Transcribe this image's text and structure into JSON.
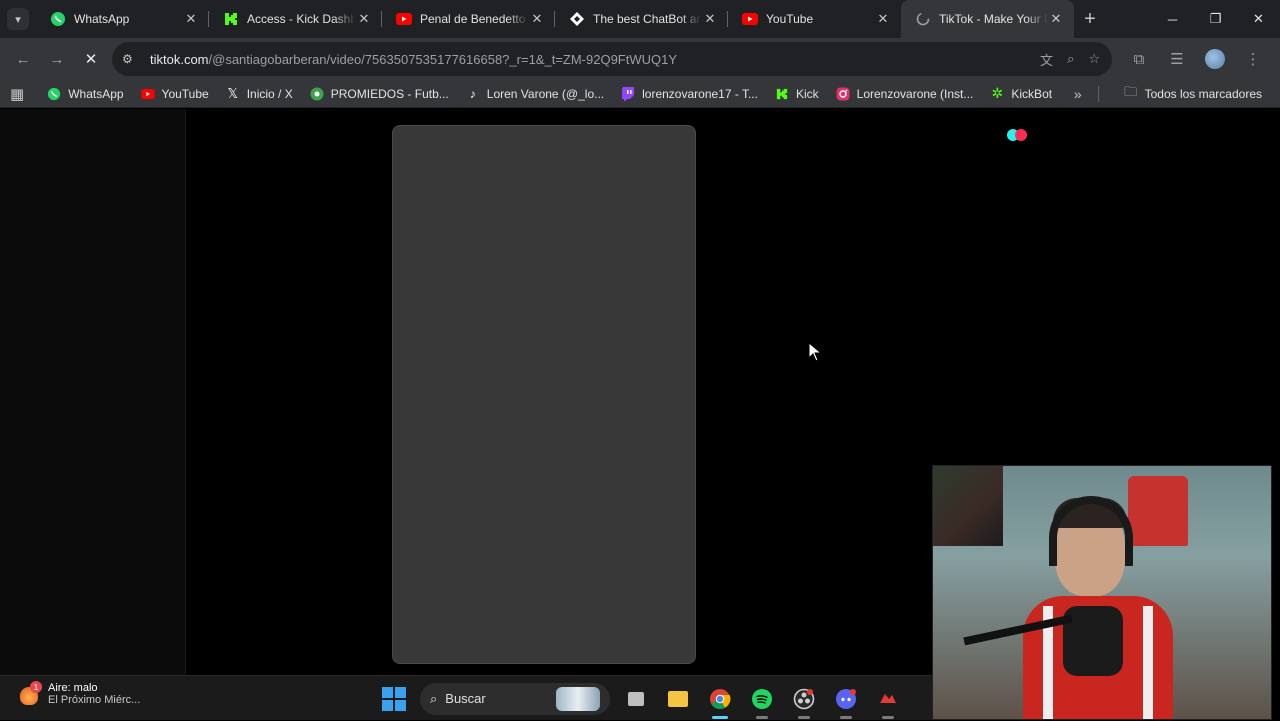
{
  "tabs": [
    {
      "title": "WhatsApp",
      "icon": "whatsapp-icon",
      "color": "#25d366",
      "active": false
    },
    {
      "title": "Access - Kick Dashboard",
      "icon": "kick-icon",
      "color": "#53fc18",
      "active": false
    },
    {
      "title": "Penal de Benedetto a",
      "icon": "youtube-icon",
      "color": "#ff0000",
      "active": false
    },
    {
      "title": "The best ChatBot and",
      "icon": "chatbot-icon",
      "color": "#ffffff",
      "active": false
    },
    {
      "title": "YouTube",
      "icon": "youtube-icon",
      "color": "#ff0000",
      "active": false
    },
    {
      "title": "TikTok - Make Your Day",
      "icon": "loading-icon",
      "color": "#9aa0a6",
      "active": true
    }
  ],
  "toolbar": {
    "url_host": "tiktok.com",
    "url_path": "/@santiagobarberan/video/7563507535177616658?_r=1&_t=ZM-92Q9FtWUQ1Y"
  },
  "bookmarks": [
    {
      "label": "WhatsApp",
      "icon": "whatsapp-icon",
      "color": "#25d366"
    },
    {
      "label": "YouTube",
      "icon": "youtube-icon",
      "color": "#ff0000"
    },
    {
      "label": "Inicio / X",
      "icon": "x-icon",
      "color": "#ffffff"
    },
    {
      "label": "PROMIEDOS - Futb...",
      "icon": "promiedos-icon",
      "color": "#3ea34b"
    },
    {
      "label": "Loren Varone (@_lo...",
      "icon": "tiktok-icon",
      "color": "#ffffff"
    },
    {
      "label": "lorenzovarone17 - T...",
      "icon": "twitch-icon",
      "color": "#9146ff"
    },
    {
      "label": "Kick",
      "icon": "kick-icon",
      "color": "#53fc18"
    },
    {
      "label": "Lorenzovarone (Inst...",
      "icon": "instagram-icon",
      "color": "#e1306c"
    },
    {
      "label": "KickBot",
      "icon": "kickbot-icon",
      "color": "#53fc18"
    }
  ],
  "bookmarks_right": {
    "all_bookmarks": "Todos los marcadores"
  },
  "taskbar": {
    "weather_title": "Aire: malo",
    "weather_sub": "El Próximo Miérc...",
    "weather_badge": "1",
    "search_placeholder": "Buscar"
  }
}
